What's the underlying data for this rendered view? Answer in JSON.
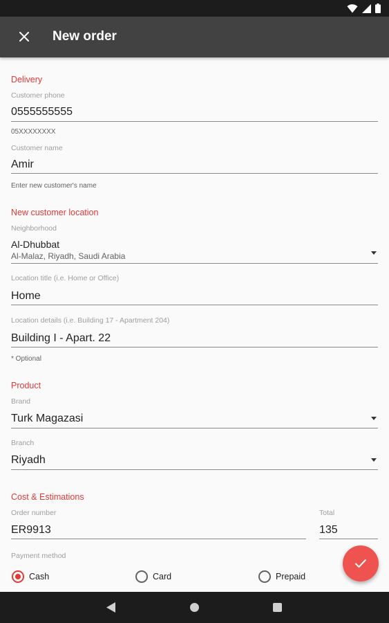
{
  "app_bar": {
    "title": "New order"
  },
  "delivery": {
    "section_title": "Delivery",
    "phone": {
      "label": "Customer phone",
      "value": "0555555555",
      "helper": "05XXXXXXXX"
    },
    "name": {
      "label": "Customer name",
      "value": "Amir",
      "helper": "Enter new customer's name"
    }
  },
  "location": {
    "section_title": "New customer location",
    "neighborhood": {
      "label": "Neighborhood",
      "value": "Al-Dhubbat",
      "sub": "Al-Malaz, Riyadh, Saudi Arabia"
    },
    "title": {
      "label": "Location title (i.e. Home or Office)",
      "value": "Home"
    },
    "details": {
      "label": "Location details (i.e. Building 17 - Apartment 204)",
      "value": "Building I - Apart. 22",
      "helper": "* Optional"
    }
  },
  "product": {
    "section_title": "Product",
    "brand": {
      "label": "Brand",
      "value": "Turk Magazasi"
    },
    "branch": {
      "label": "Branch",
      "value": "Riyadh"
    }
  },
  "cost": {
    "section_title": "Cost & Estimations",
    "order_number": {
      "label": "Order number",
      "value": "ER9913"
    },
    "total": {
      "label": "Total",
      "value": "135"
    },
    "payment": {
      "label": "Payment method",
      "options": [
        {
          "label": "Cash",
          "selected": true
        },
        {
          "label": "Card",
          "selected": false
        },
        {
          "label": "Prepaid",
          "selected": false
        }
      ]
    }
  },
  "icons": {
    "close": "close-icon",
    "confirm": "check-icon",
    "dropdown": "arrow-drop-down-icon",
    "wifi": "wifi-icon",
    "signal": "signal-icon",
    "battery": "battery-icon",
    "nav_back": "nav-back-icon",
    "nav_home": "nav-home-icon",
    "nav_recent": "nav-recent-icon"
  },
  "colors": {
    "accent": "#e53935",
    "fab": "#ef5350",
    "app_bar": "#424242",
    "system_bars": "#1c1c1c",
    "background": "#fafafa"
  }
}
